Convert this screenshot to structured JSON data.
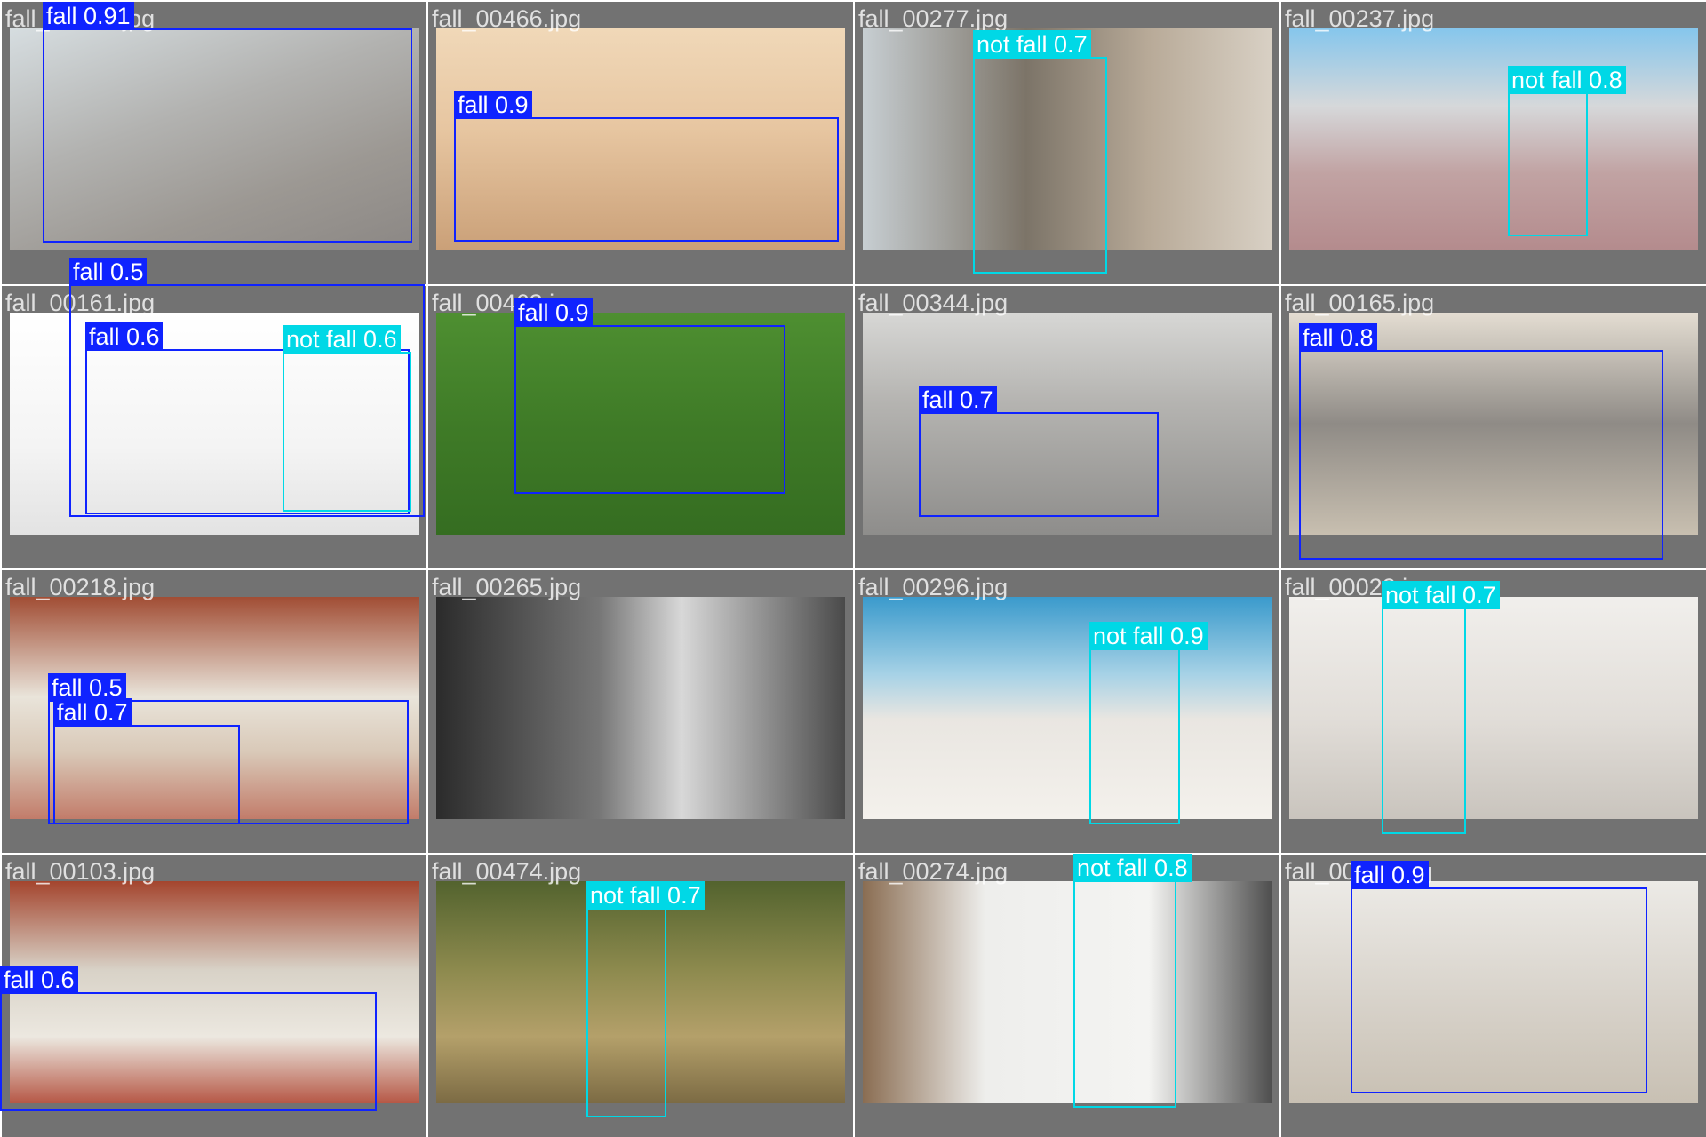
{
  "colors": {
    "fall": "#0f23ff",
    "not_fall": "#00d8e6",
    "tile_bg": "#727272"
  },
  "tiles": [
    {
      "file": "fall_00091.jpg",
      "bg": "linear-gradient(160deg,#d6dde0 0%,#b2b2b0 40%,#9c9893 70%,#8b8784 100%)",
      "det": [
        {
          "cls": "fall",
          "label": "fall 0.91"
        }
      ]
    },
    {
      "file": "fall_00466.jpg",
      "bg": "linear-gradient(180deg,#f0d8b8 0%,#e7c6a1 45%,#caa078 100%)",
      "det": [
        {
          "cls": "fall",
          "label": "fall 0.9"
        }
      ]
    },
    {
      "file": "fall_00277.jpg",
      "bg": "linear-gradient(90deg,#c7ced2 0%,#7c7468 40%,#b8aa98 70%,#d8d0c4 100%)",
      "det": [
        {
          "cls": "not_fall",
          "label": "not fall 0.7"
        }
      ]
    },
    {
      "file": "fall_00237.jpg",
      "bg": "linear-gradient(180deg,#86c6ec 0%,#d6d8da 35%,#c1a3a3 65%,#b48b8d 100%)",
      "det": [
        {
          "cls": "not_fall",
          "label": "not fall 0.8"
        }
      ]
    },
    {
      "file": "fall_00161.jpg",
      "bg": "linear-gradient(180deg,#ffffff 0%,#f4f4f4 60%,#e3e3e3 100%)",
      "det": [
        {
          "cls": "fall",
          "label": "fall 0.5"
        },
        {
          "cls": "fall",
          "label": "fall 0.6"
        },
        {
          "cls": "not_fall",
          "label": "not fall 0.6"
        }
      ]
    },
    {
      "file": "fall_00463.jpg",
      "bg": "linear-gradient(180deg,#4e8f31 0%,#3f7b27 50%,#356d21 100%)",
      "det": [
        {
          "cls": "fall",
          "label": "fall 0.9"
        }
      ]
    },
    {
      "file": "fall_00344.jpg",
      "bg": "linear-gradient(180deg,#d7d7d5 0%,#b5b4b1 40%,#8e8d8b 100%)",
      "det": [
        {
          "cls": "fall",
          "label": "fall 0.7"
        }
      ]
    },
    {
      "file": "fall_00165.jpg",
      "bg": "linear-gradient(180deg,#e4ddd2 0%,#8f8b86 50%,#c8bfb0 100%)",
      "det": [
        {
          "cls": "fall",
          "label": "fall 0.8"
        }
      ]
    },
    {
      "file": "fall_00218.jpg",
      "bg": "linear-gradient(180deg,#a14d34 0%,#e9e4da 45%,#d9c9b8 70%,#c27c6a 100%)",
      "det": [
        {
          "cls": "fall",
          "label": "fall 0.5"
        },
        {
          "cls": "fall",
          "label": "fall 0.7"
        }
      ]
    },
    {
      "file": "fall_00265.jpg",
      "bg": "linear-gradient(90deg,#2b2b2b 0%,#777777 40%,#d8d8d8 60%,#4a4a4a 100%)",
      "det": []
    },
    {
      "file": "fall_00296.jpg",
      "bg": "linear-gradient(180deg,#3a9acc 0%,#a7d2e6 35%,#e9e6e1 55%,#f4f1ec 100%)",
      "det": [
        {
          "cls": "not_fall",
          "label": "not fall 0.9"
        }
      ]
    },
    {
      "file": "fall_00022.jpg",
      "bg": "linear-gradient(180deg,#f1efec 0%,#e1ddd8 55%,#c9c4bd 100%)",
      "det": [
        {
          "cls": "not_fall",
          "label": "not fall 0.7"
        }
      ]
    },
    {
      "file": "fall_00103.jpg",
      "bg": "linear-gradient(180deg,#a4452e 0%,#d8d2c7 40%,#ece8e0 70%,#b65846 100%)",
      "det": [
        {
          "cls": "fall",
          "label": "fall 0.6"
        }
      ]
    },
    {
      "file": "fall_00474.jpg",
      "bg": "linear-gradient(180deg,#53632e 0%,#8d8a4e 40%,#b4a06a 70%,#7c6b44 100%)",
      "det": [
        {
          "cls": "not_fall",
          "label": "not fall 0.7"
        }
      ]
    },
    {
      "file": "fall_00274.jpg",
      "bg": "linear-gradient(90deg,#8a6d52 0%,#eeeeec 30%,#f4f4f2 70%,#4f4f4f 100%)",
      "det": [
        {
          "cls": "not_fall",
          "label": "not fall 0.8"
        }
      ]
    },
    {
      "file": "fall_00011.jpg",
      "bg": "linear-gradient(180deg,#eceae6 0%,#d9d4cc 50%,#c8c0b3 100%)",
      "det": [
        {
          "cls": "fall",
          "label": "fall 0.9"
        }
      ]
    }
  ]
}
